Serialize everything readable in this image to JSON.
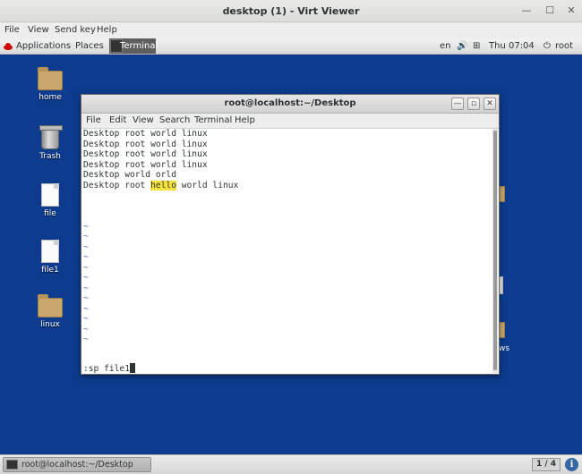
{
  "viewer": {
    "title": "desktop (1) - Virt Viewer",
    "menu": [
      "File",
      "View",
      "Send key",
      "Help"
    ]
  },
  "guest_panel": {
    "applications": "Applications",
    "places": "Places",
    "terminal_task": "Terminal",
    "lang": "en",
    "clock": "Thu 07:04",
    "user": "root"
  },
  "desktop_icons": [
    {
      "label": "home",
      "icon": "home-folder-icon"
    },
    {
      "label": "Trash",
      "icon": "trash-icon"
    },
    {
      "label": "file",
      "icon": "text-file-icon"
    },
    {
      "label": "file1",
      "icon": "text-file-icon"
    },
    {
      "label": "linux",
      "icon": "folder-icon"
    }
  ],
  "hidden_icon_fragment": "ws",
  "terminal": {
    "title": "root@localhost:~/Desktop",
    "menu": [
      "File",
      "Edit",
      "View",
      "Search",
      "Terminal",
      "Help"
    ],
    "lines": [
      "Desktop root world linux",
      "Desktop root world linux",
      "Desktop root world linux",
      "Desktop root world linux",
      "Desktop world orld"
    ],
    "last_line": {
      "before": "Desktop root ",
      "highlight": "hello",
      "after": " world linux"
    },
    "tilde": "~",
    "command": ":sp file1"
  },
  "guest_bottom": {
    "task_label": "root@localhost:~/Desktop",
    "pager": "1 / 4",
    "info_icon": "i"
  },
  "colors": {
    "desktop_bg": "#0d3c8f",
    "search_highlight": "#f5e13b"
  }
}
